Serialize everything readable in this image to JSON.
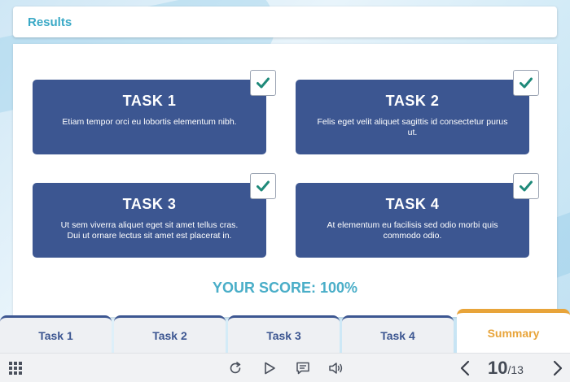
{
  "header": {
    "title": "Results"
  },
  "tasks": [
    {
      "title": "TASK 1",
      "description": "Etiam tempor orci eu lobortis elementum nibh.",
      "completed": true
    },
    {
      "title": "TASK 2",
      "description": "Felis eget velit aliquet sagittis id consectetur purus ut.",
      "completed": true
    },
    {
      "title": "TASK 3",
      "description": "Ut sem viverra aliquet eget sit amet tellus cras. Dui ut ornare lectus sit amet est placerat in.",
      "completed": true
    },
    {
      "title": "TASK 4",
      "description": "At elementum eu facilisis sed odio morbi quis commodo odio.",
      "completed": true
    }
  ],
  "score": {
    "label": "YOUR SCORE: 100%"
  },
  "tabs": [
    {
      "label": "Task 1",
      "active": false
    },
    {
      "label": "Task 2",
      "active": false
    },
    {
      "label": "Task 3",
      "active": false
    },
    {
      "label": "Task 4",
      "active": false
    },
    {
      "label": "Summary",
      "active": true
    }
  ],
  "toolbar": {
    "icons": [
      "grid-menu-icon",
      "replay-icon",
      "play-icon",
      "transcript-icon",
      "volume-icon",
      "prev-arrow-icon",
      "next-arrow-icon"
    ],
    "page_current": "10",
    "page_total": "/13"
  },
  "colors": {
    "card": "#3c5691",
    "accent": "#3aa9c6",
    "check": "#1f8a7a",
    "active_tab": "#e8a43a"
  }
}
